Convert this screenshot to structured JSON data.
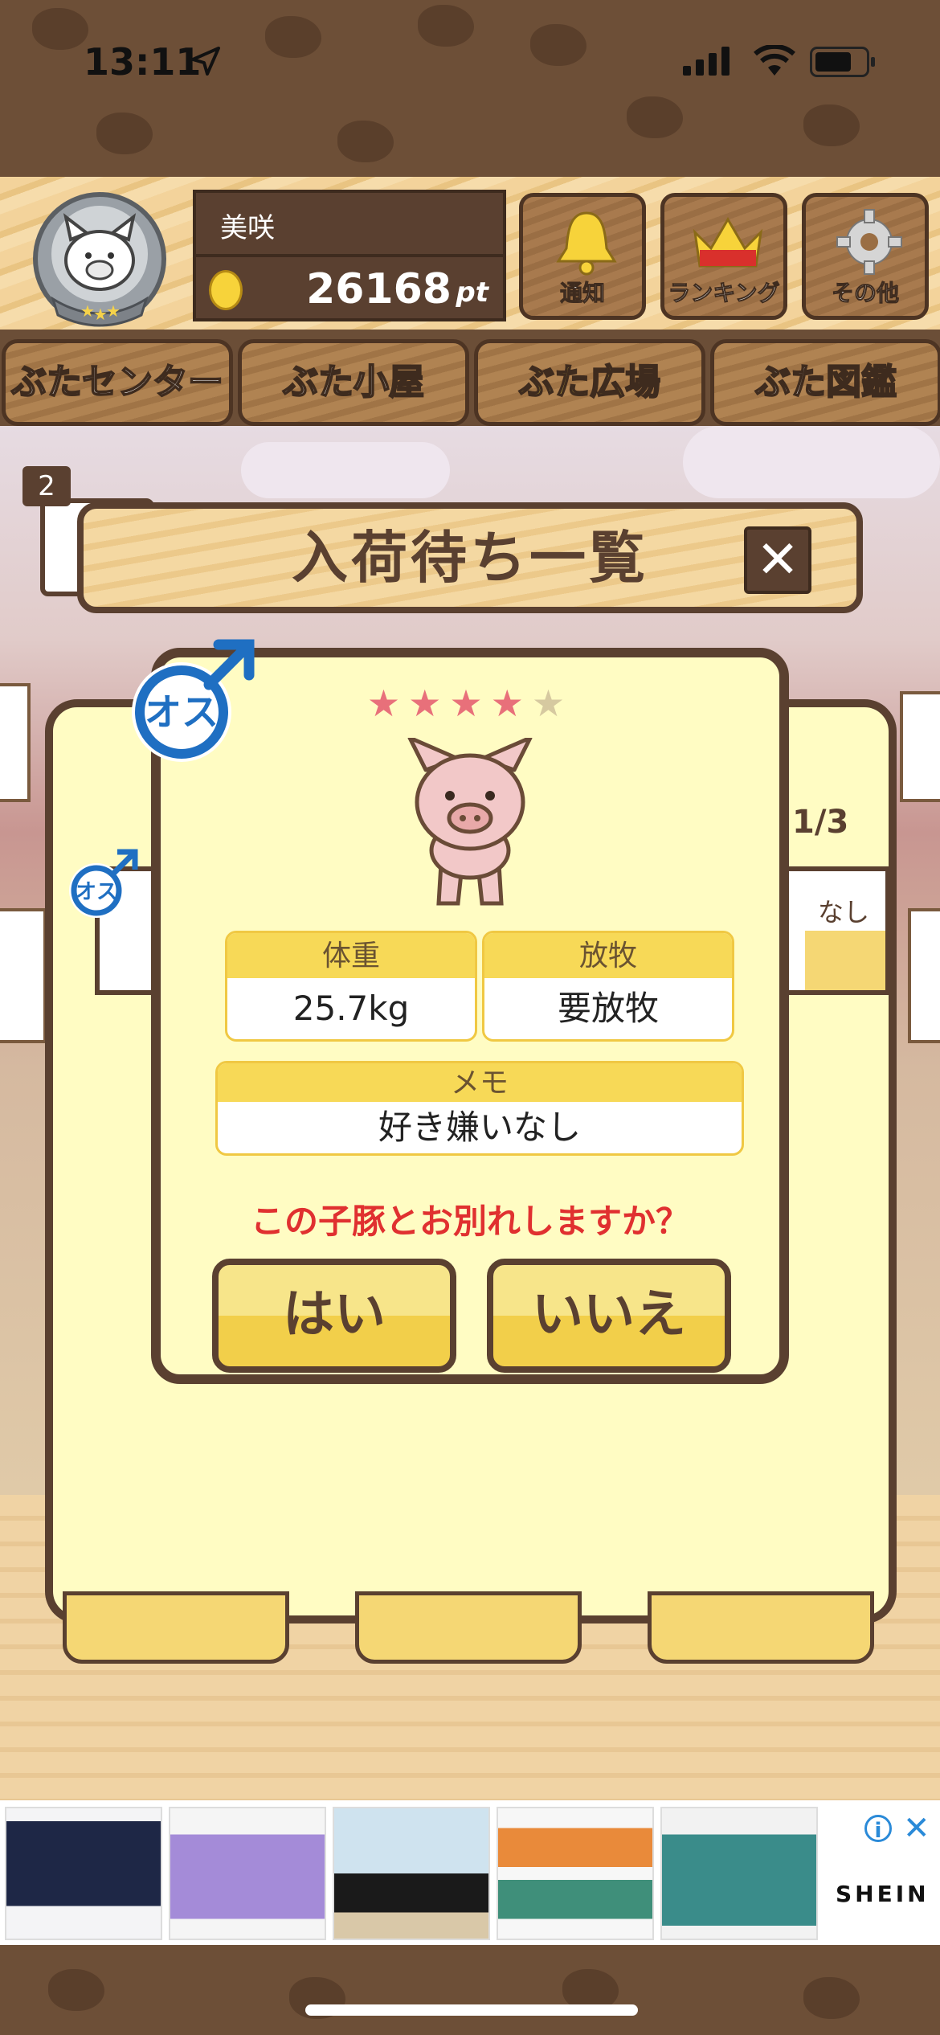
{
  "status_bar": {
    "time": "13:11"
  },
  "header": {
    "user_name": "美咲",
    "points_value": "26168",
    "points_unit": "pt",
    "buttons": [
      {
        "label": "通知",
        "icon": "bell-icon"
      },
      {
        "label": "ランキング",
        "icon": "crown-icon"
      },
      {
        "label": "その他",
        "icon": "gear-icon"
      }
    ]
  },
  "tabs": [
    "ぶたセンター",
    "ぶた小屋",
    "ぶた広場",
    "ぶた図鑑"
  ],
  "active_tab": 2,
  "notice_badge": "2",
  "modal": {
    "title": "入荷待ち一覧",
    "close_label": "✕"
  },
  "dialog": {
    "rating": 4,
    "rating_max": 5,
    "gender_badge": "オス",
    "fields": {
      "weight": {
        "label": "体重",
        "value": "25.7kg"
      },
      "grazing": {
        "label": "放牧",
        "value": "要放牧"
      },
      "memo": {
        "label": "メモ",
        "value": "好き嫌いなし"
      }
    },
    "question": "この子豚とお別れしますか？",
    "yes_label": "はい",
    "no_label": "いいえ"
  },
  "background_panel": {
    "page_indicator": "1/3",
    "partial_text": "なし",
    "gender_badge": "オス"
  },
  "ad": {
    "brand": "SHEIN",
    "info_label": "i",
    "close_label": "✕"
  },
  "colors": {
    "accent_yellow": "#f7d957",
    "wood_dark": "#5a4030",
    "question_red": "#e03030",
    "star_pink": "#e8707a",
    "male_blue": "#1f6fc2"
  }
}
